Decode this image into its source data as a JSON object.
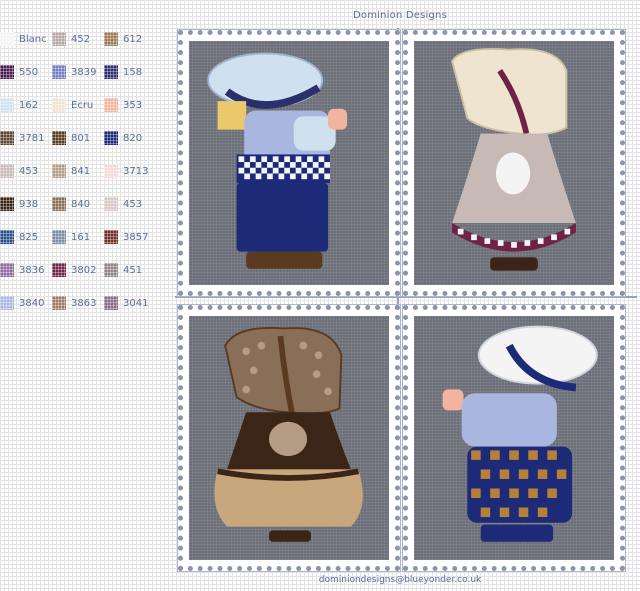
{
  "header": {
    "title": "Dominion Designs"
  },
  "footer": {
    "email": "dominiondesigns@blueyonder.co.uk"
  },
  "legend": {
    "items": [
      {
        "code": "Blanc",
        "color": "#f4f4f4"
      },
      {
        "code": "452",
        "color": "#b5a8a5"
      },
      {
        "code": "612",
        "color": "#9c7a57"
      },
      {
        "code": "550",
        "color": "#4a1a4f"
      },
      {
        "code": "3839",
        "color": "#6f7fc0"
      },
      {
        "code": "158",
        "color": "#2c2f6e"
      },
      {
        "code": "162",
        "color": "#cfe0ee"
      },
      {
        "code": "Ecru",
        "color": "#eee4cf"
      },
      {
        "code": "353",
        "color": "#f2b4a0"
      },
      {
        "code": "3781",
        "color": "#5a4632"
      },
      {
        "code": "801",
        "color": "#5b3a22"
      },
      {
        "code": "820",
        "color": "#1c2a78"
      },
      {
        "code": "453",
        "color": "#c7b9b5"
      },
      {
        "code": "841",
        "color": "#b59c87"
      },
      {
        "code": "3713",
        "color": "#f5d9d8"
      },
      {
        "code": "938",
        "color": "#3b2516"
      },
      {
        "code": "840",
        "color": "#8a6f58"
      },
      {
        "code": "453",
        "color": "#d8c6c4"
      },
      {
        "code": "825",
        "color": "#2a4f8c"
      },
      {
        "code": "161",
        "color": "#7b8ba8"
      },
      {
        "code": "3857",
        "color": "#6e2e2a"
      },
      {
        "code": "3836",
        "color": "#8e6a9e"
      },
      {
        "code": "3802",
        "color": "#6e2244"
      },
      {
        "code": "451",
        "color": "#8e8584"
      },
      {
        "code": "3840",
        "color": "#a9b7e0"
      },
      {
        "code": "3863",
        "color": "#9c7c66"
      },
      {
        "code": "3041",
        "color": "#8a6a7e"
      }
    ]
  },
  "colors": {
    "panel_bg": "#6b6f77",
    "text_accent": "#5a6f9a"
  }
}
